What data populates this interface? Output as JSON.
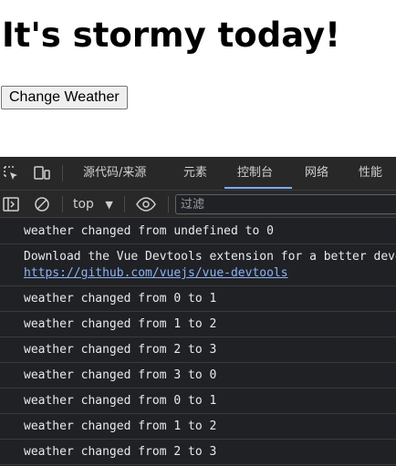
{
  "page": {
    "title": "It's stormy today!",
    "button_label": "Change Weather"
  },
  "devtools": {
    "tabs": [
      {
        "label": "源代码/来源"
      },
      {
        "label": "元素"
      },
      {
        "label": "控制台"
      },
      {
        "label": "网络"
      },
      {
        "label": "性能"
      }
    ],
    "active_tab": "控制台",
    "context": "top",
    "filter_placeholder": "过滤",
    "colors": {
      "accent": "#7cacf8",
      "background": "#202124",
      "link": "#8ab4f8"
    }
  },
  "console": {
    "messages": [
      {
        "text": "weather changed from undefined to 0"
      },
      {
        "text": "Download the Vue Devtools extension for a better development experience:",
        "link": "https://github.com/vuejs/vue-devtools"
      },
      {
        "text": "weather changed from 0 to 1"
      },
      {
        "text": "weather changed from 1 to 2"
      },
      {
        "text": "weather changed from 2 to 3"
      },
      {
        "text": "weather changed from 3 to 0"
      },
      {
        "text": "weather changed from 0 to 1"
      },
      {
        "text": "weather changed from 1 to 2"
      },
      {
        "text": "weather changed from 2 to 3"
      }
    ]
  }
}
